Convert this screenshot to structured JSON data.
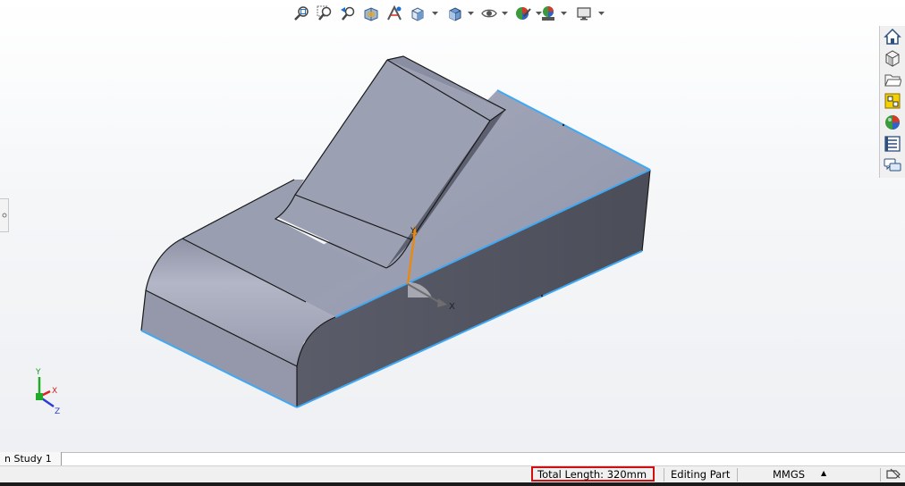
{
  "hud_toolbar": {
    "icons": [
      "zoom-to-fit-icon",
      "zoom-to-area-icon",
      "previous-view-icon",
      "section-view-icon",
      "dynamic-annotation-icon",
      "view-orientation-icon",
      "display-style-icon",
      "hide-show-items-icon",
      "edit-appearance-icon",
      "apply-scene-icon",
      "view-settings-icon"
    ]
  },
  "task_pane": {
    "icons": [
      "solidworks-resources-icon",
      "design-library-icon",
      "file-explorer-icon",
      "view-palette-icon",
      "appearances-scenes-icon",
      "custom-properties-icon",
      "forum-icon"
    ]
  },
  "triad": {
    "x": "X",
    "y": "Y",
    "z": "Z"
  },
  "selection_triad": {
    "x": "X",
    "y": "Y"
  },
  "colors": {
    "selected_edge": "#3fa9f5",
    "model_face_top": "#9ea3b6",
    "model_face_side": "#50525f",
    "accent_red": "#d01010"
  },
  "bottom_tab": {
    "label": "n Study 1"
  },
  "status_bar": {
    "total_length": "Total Length: 320mm",
    "mode": "Editing Part",
    "units": "MMGS",
    "units_caret": "▲"
  }
}
